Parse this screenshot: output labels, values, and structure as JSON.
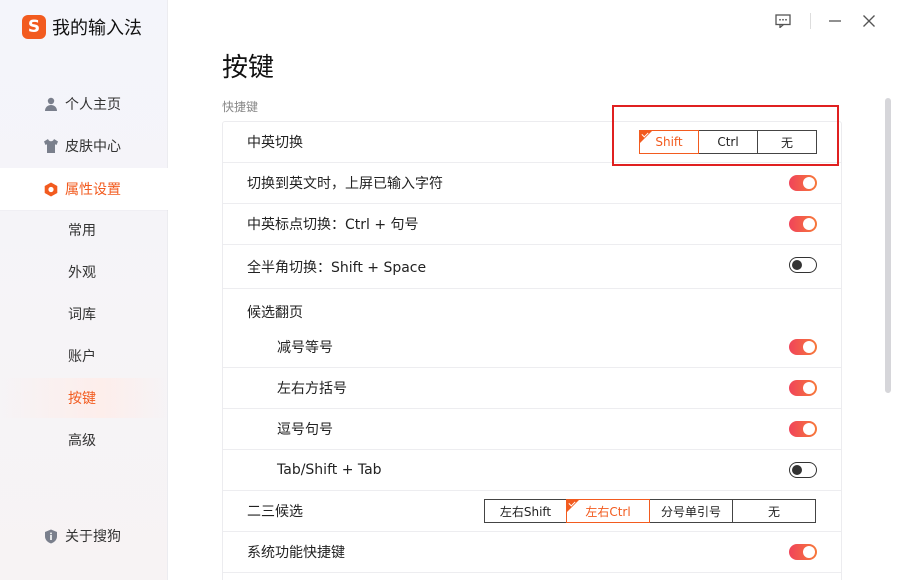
{
  "app": {
    "title": "我的输入法",
    "logo_letter": "S",
    "brand_color": "#f25b1f"
  },
  "sidebar": {
    "items": [
      {
        "label": "个人主页",
        "icon": "person-icon"
      },
      {
        "label": "皮肤中心",
        "icon": "shirt-icon"
      },
      {
        "label": "属性设置",
        "icon": "hexagon-settings-icon"
      }
    ],
    "sub_items": [
      "常用",
      "外观",
      "词库",
      "账户",
      "按键",
      "高级"
    ],
    "active_sub": "按键",
    "about": {
      "label": "关于搜狗",
      "icon": "shield-info-icon"
    }
  },
  "window_controls": [
    "feedback-icon",
    "minimize-icon",
    "close-icon"
  ],
  "page": {
    "title": "按键",
    "section_label": "快捷键"
  },
  "settings": {
    "cn_en_switch": {
      "label": "中英切换",
      "options": [
        "Shift",
        "Ctrl",
        "无"
      ],
      "selected": "Shift"
    },
    "commit_on_switch": {
      "label": "切换到英文时，上屏已输入字符",
      "on": true
    },
    "punct_switch": {
      "label": "中英标点切换：Ctrl + 句号",
      "on": true
    },
    "width_switch": {
      "label": "全半角切换：Shift + Space",
      "on": false
    },
    "paging": {
      "label": "候选翻页",
      "items": [
        {
          "label": "减号等号",
          "on": true
        },
        {
          "label": "左右方括号",
          "on": true
        },
        {
          "label": "逗号句号",
          "on": true
        },
        {
          "label": "Tab/Shift + Tab",
          "on": false
        }
      ]
    },
    "second_third": {
      "label": "二三候选",
      "options": [
        "左右Shift",
        "左右Ctrl",
        "分号单引号",
        "无"
      ],
      "selected": "左右Ctrl"
    },
    "system_hotkeys": {
      "label": "系统功能快捷键",
      "on": true
    }
  },
  "accent_gradient": [
    "#f0445a",
    "#f7793a"
  ],
  "highlight_color": "#e02020"
}
